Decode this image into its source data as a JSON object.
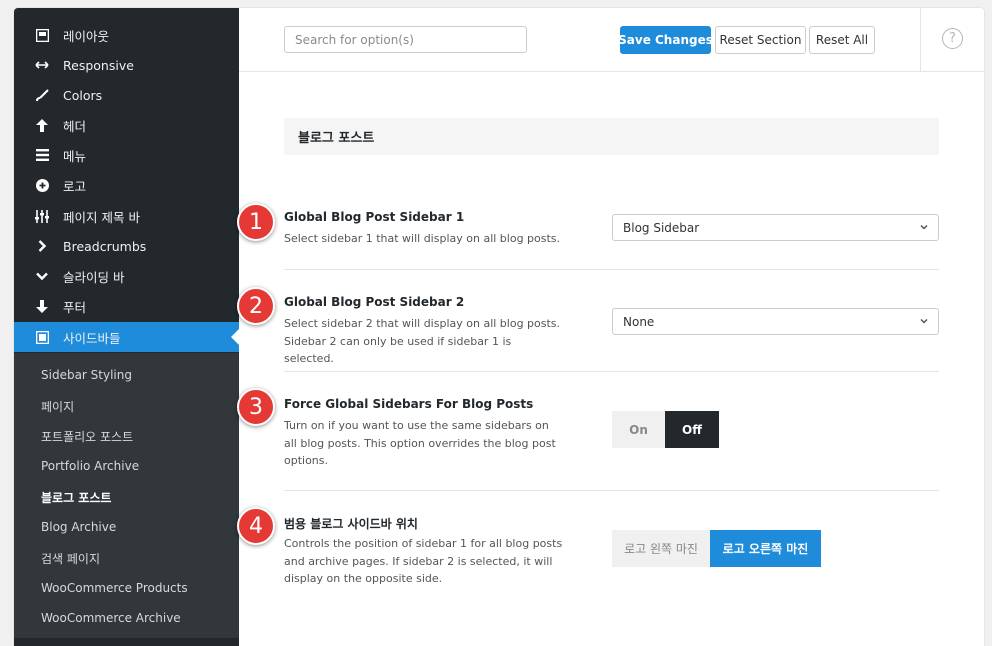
{
  "sidebar": {
    "items": [
      {
        "label": "레이아웃",
        "icon": "layout-icon"
      },
      {
        "label": "Responsive",
        "icon": "arrows-horizontal-icon"
      },
      {
        "label": "Colors",
        "icon": "brush-icon"
      },
      {
        "label": "헤더",
        "icon": "arrow-up-icon"
      },
      {
        "label": "메뉴",
        "icon": "menu-icon"
      },
      {
        "label": "로고",
        "icon": "plus-circle-icon"
      },
      {
        "label": "페이지 제목 바",
        "icon": "sliders-icon"
      },
      {
        "label": "Breadcrumbs",
        "icon": "chevron-right-icon"
      },
      {
        "label": "슬라이딩 바",
        "icon": "chevron-down-icon"
      },
      {
        "label": "푸터",
        "icon": "arrow-down-icon"
      },
      {
        "label": "사이드바들",
        "icon": "sidebar-icon"
      }
    ],
    "sub_items": [
      "Sidebar Styling",
      "페이지",
      "포트폴리오 포스트",
      "Portfolio Archive",
      "블로그 포스트",
      "Blog Archive",
      "검색 페이지",
      "WooCommerce Products",
      "WooCommerce Archive"
    ]
  },
  "toolbar": {
    "search_placeholder": "Search for option(s)",
    "save_label": "Save Changes",
    "reset_section_label": "Reset Section",
    "reset_all_label": "Reset All",
    "help_glyph": "?"
  },
  "section": {
    "title": "블로그 포스트"
  },
  "options": [
    {
      "badge": "1",
      "title": "Global Blog Post Sidebar 1",
      "desc": "Select sidebar 1 that will display on all blog posts.",
      "value": "Blog Sidebar"
    },
    {
      "badge": "2",
      "title": "Global Blog Post Sidebar 2",
      "desc": "Select sidebar 2 that will display on all blog posts. Sidebar 2 can only be used if sidebar 1 is selected.",
      "value": "None"
    },
    {
      "badge": "3",
      "title": "Force Global Sidebars For Blog Posts",
      "desc": "Turn on if you want to use the same sidebars on all blog posts. This option overrides the blog post options.",
      "on_label": "On",
      "off_label": "Off",
      "selected": "Off"
    },
    {
      "badge": "4",
      "title": "범용 블로그 사이드바 위치",
      "desc": "Controls the position of sidebar 1 for all blog posts and archive pages. If sidebar 2 is selected, it will display on the opposite side.",
      "left_label": "로고 왼쪽 마진",
      "right_label": "로고 오른쪽 마진",
      "selected": "로고 오른쪽 마진"
    }
  ],
  "colors": {
    "accent": "#1e8cdb",
    "sidebar_bg": "#23282d",
    "badge": "#e53935"
  }
}
